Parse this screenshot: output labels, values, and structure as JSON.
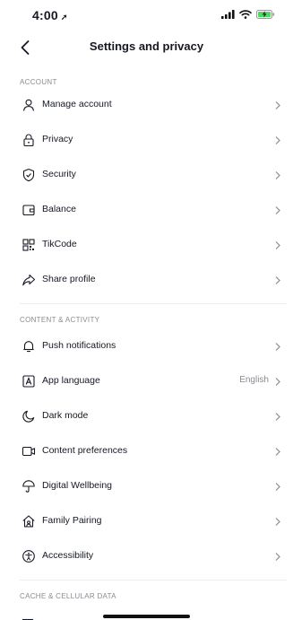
{
  "status_bar": {
    "time": "4:00",
    "location_glyph": "➚"
  },
  "nav": {
    "title": "Settings and privacy"
  },
  "sections": {
    "account": {
      "title": "ACCOUNT",
      "items": [
        {
          "label": "Manage account",
          "icon": "person-icon"
        },
        {
          "label": "Privacy",
          "icon": "lock-icon"
        },
        {
          "label": "Security",
          "icon": "shield-icon"
        },
        {
          "label": "Balance",
          "icon": "wallet-icon"
        },
        {
          "label": "TikCode",
          "icon": "qr-code-icon"
        },
        {
          "label": "Share profile",
          "icon": "share-icon"
        }
      ]
    },
    "content": {
      "title": "CONTENT & ACTIVITY",
      "items": [
        {
          "label": "Push notifications",
          "icon": "bell-icon"
        },
        {
          "label": "App language",
          "icon": "language-icon",
          "value": "English"
        },
        {
          "label": "Dark mode",
          "icon": "moon-icon"
        },
        {
          "label": "Content preferences",
          "icon": "video-icon"
        },
        {
          "label": "Digital Wellbeing",
          "icon": "umbrella-icon"
        },
        {
          "label": "Family Pairing",
          "icon": "house-icon"
        },
        {
          "label": "Accessibility",
          "icon": "accessibility-icon"
        }
      ]
    },
    "cache": {
      "title": "CACHE & CELLULAR DATA"
    }
  },
  "colors": {
    "text": "#161823",
    "secondary": "#8a8b91",
    "divider": "#ececec"
  }
}
